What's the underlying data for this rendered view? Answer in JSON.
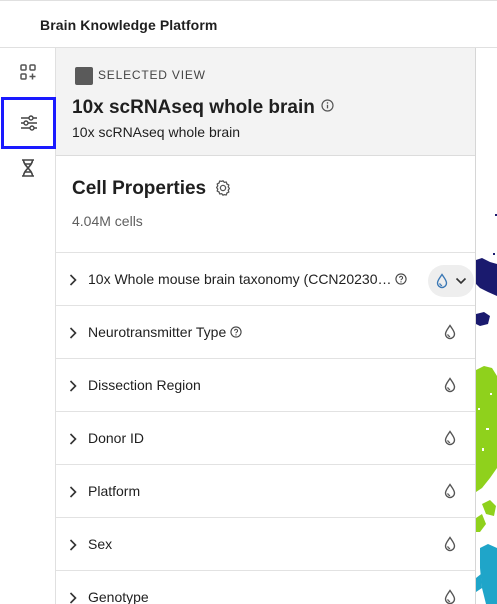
{
  "app": {
    "title": "Brain Knowledge Platform"
  },
  "rail": {
    "items": [
      {
        "icon": "add-widget-icon"
      },
      {
        "icon": "sliders-icon",
        "active": true
      },
      {
        "icon": "dna-icon"
      }
    ]
  },
  "view": {
    "eyebrow": "SELECTED VIEW",
    "title": "10x scRNAseq whole brain",
    "subtitle": "10x scRNAseq whole brain"
  },
  "cell_properties": {
    "title": "Cell Properties",
    "count": "4.04M cells",
    "items": [
      {
        "label": "10x Whole mouse brain taxonomy (CCN20230…",
        "has_info": true,
        "active_color": true
      },
      {
        "label": "Neurotransmitter Type",
        "has_info": true
      },
      {
        "label": "Dissection Region"
      },
      {
        "label": "Donor ID"
      },
      {
        "label": "Platform"
      },
      {
        "label": "Sex"
      },
      {
        "label": "Genotype"
      }
    ]
  },
  "colors": {
    "accent_selected": "#1a1aff",
    "drop_active": "#3b78b5",
    "navy": "#1a1a6e",
    "lime": "#8fd11c",
    "cyan": "#1fa5c9"
  }
}
